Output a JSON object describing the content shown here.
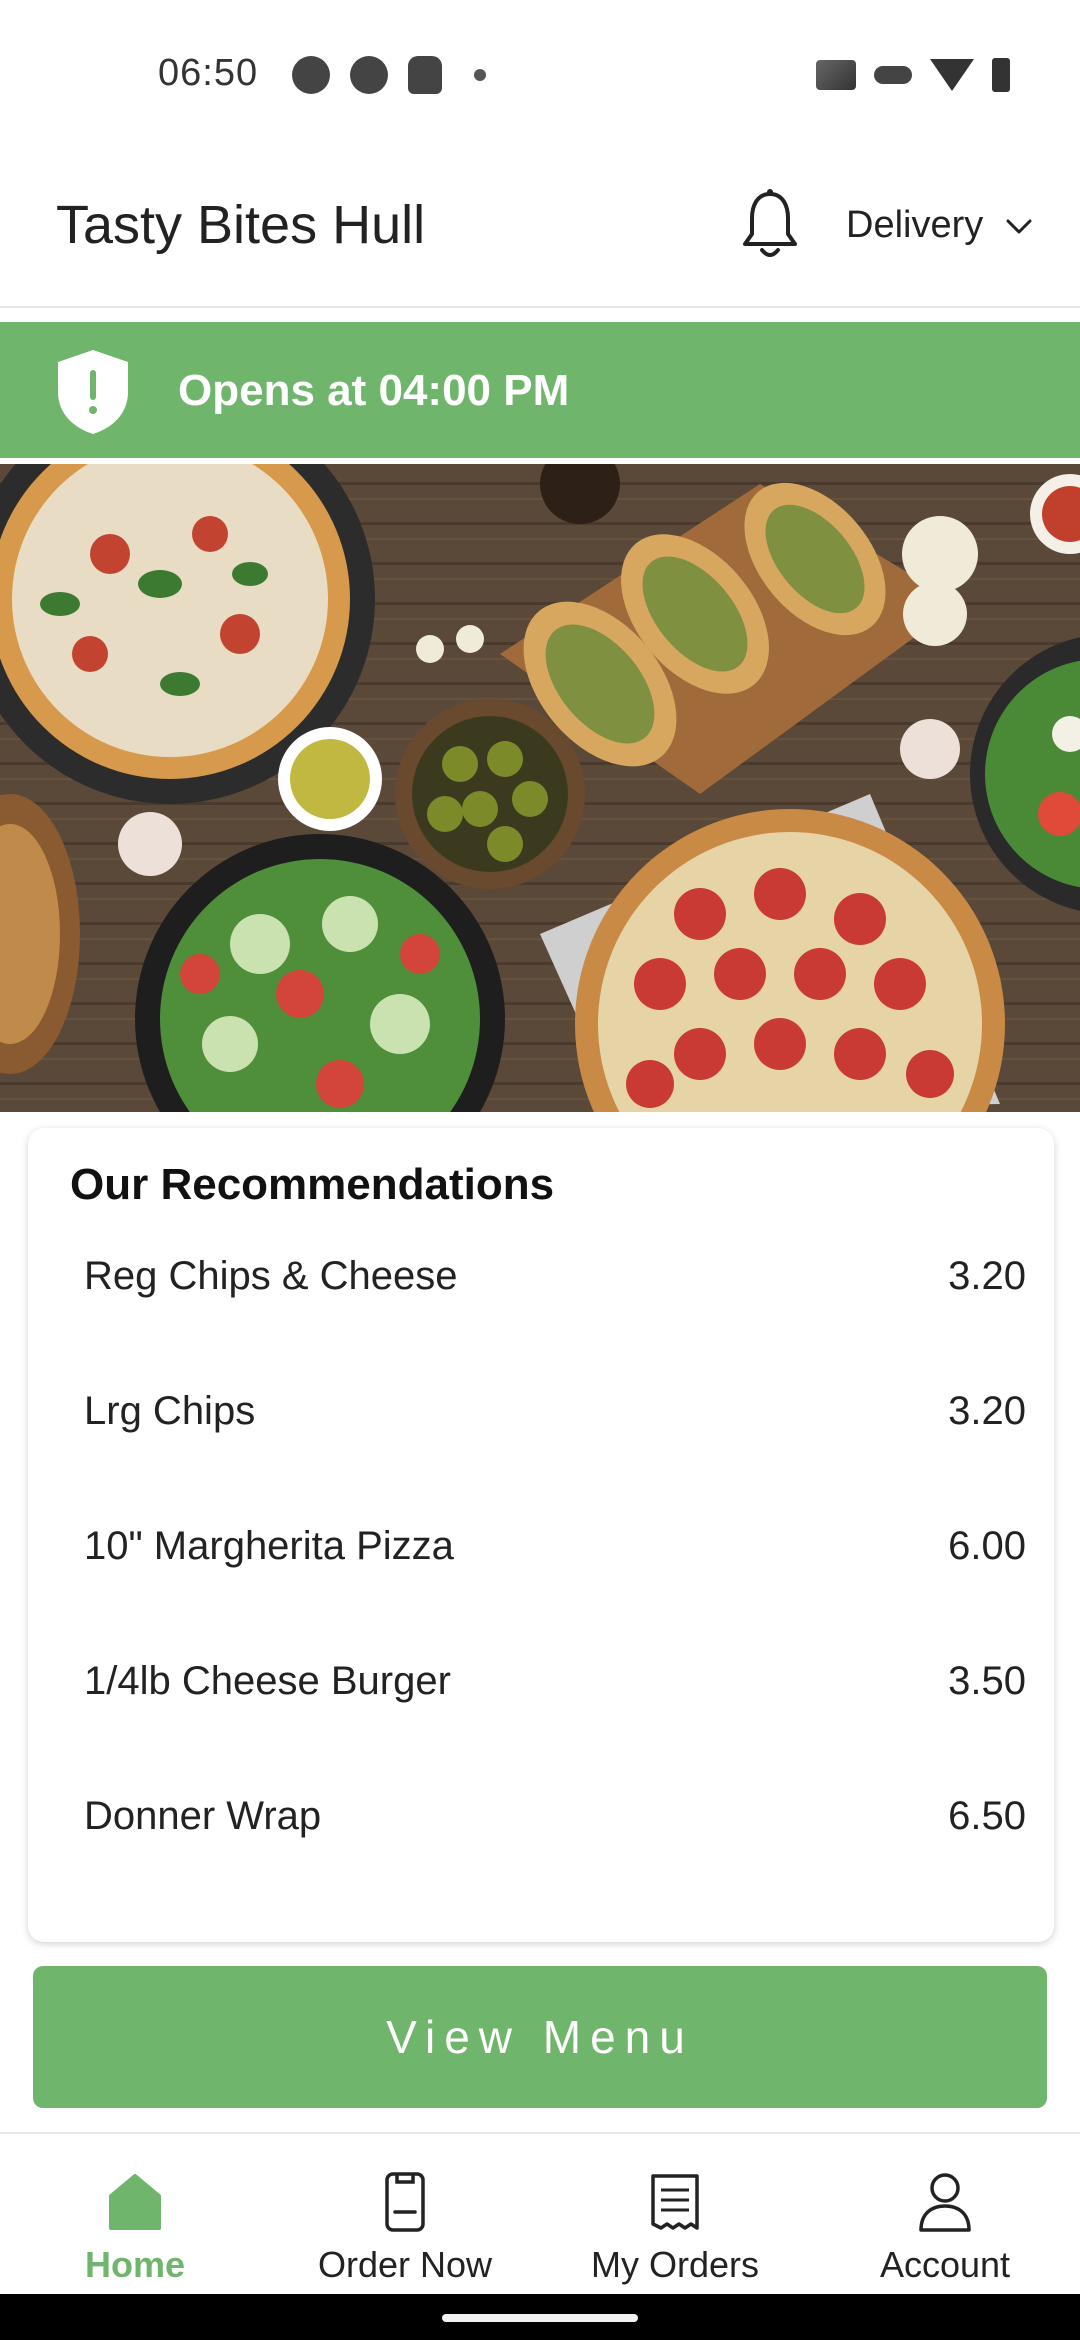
{
  "status_bar": {
    "time": "06:50",
    "left_icons": [
      "p-app-icon",
      "sync-icon",
      "android-icon",
      "notification-dot-icon"
    ],
    "right_icons": [
      "cast-icon",
      "vpn-key-icon",
      "wifi-icon",
      "battery-charging-icon"
    ]
  },
  "header": {
    "title": "Tasty Bites Hull",
    "notification_icon": "bell-icon",
    "order_mode": "Delivery"
  },
  "banner": {
    "text": "Opens at 04:00 PM",
    "icon": "shield-alert-icon"
  },
  "recommendations": {
    "title": "Our Recommendations",
    "items": [
      {
        "name": "Reg Chips & Cheese",
        "price": "3.20"
      },
      {
        "name": "Lrg Chips",
        "price": "3.20"
      },
      {
        "name": "10\" Margherita Pizza",
        "price": "6.00"
      },
      {
        "name": "1/4lb Cheese Burger",
        "price": "3.50"
      },
      {
        "name": "Donner Wrap",
        "price": "6.50"
      }
    ]
  },
  "view_menu_label": "View Menu",
  "bottom_nav": [
    {
      "label": "Home",
      "icon": "home-icon",
      "active": true
    },
    {
      "label": "Order Now",
      "icon": "order-icon",
      "active": false
    },
    {
      "label": "My Orders",
      "icon": "receipt-icon",
      "active": false
    },
    {
      "label": "Account",
      "icon": "person-icon",
      "active": false
    }
  ],
  "colors": {
    "accent": "#6fb56b",
    "text": "#222222",
    "background": "#ffffff"
  }
}
